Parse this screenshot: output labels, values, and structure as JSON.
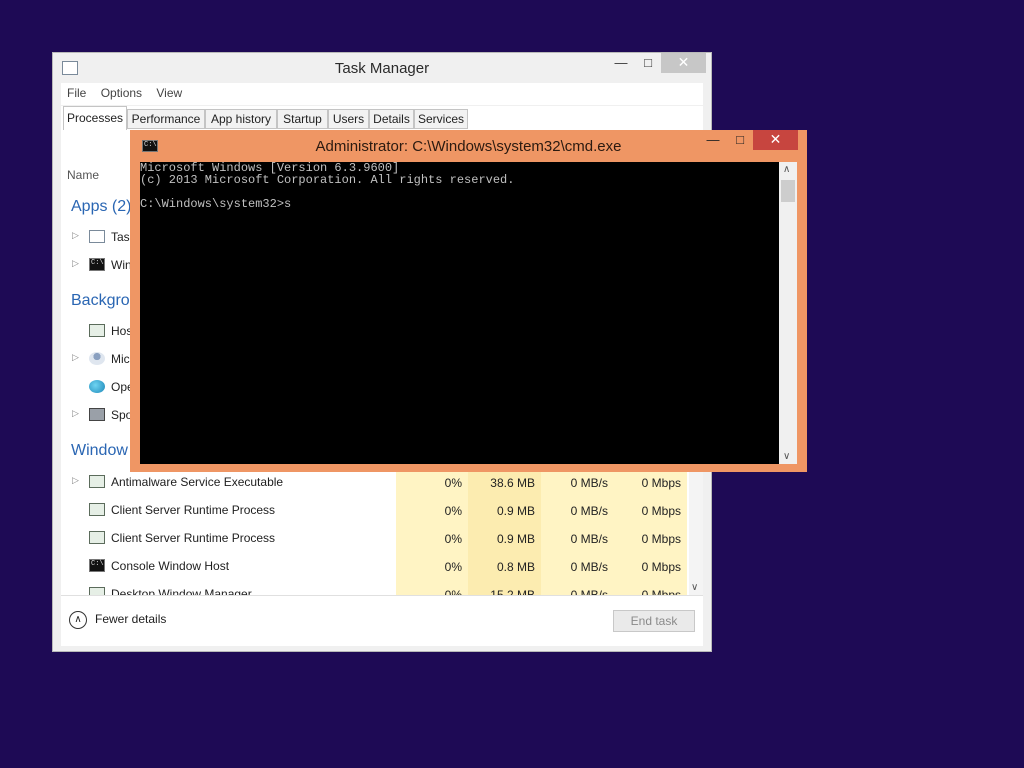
{
  "task_manager": {
    "title": "Task Manager",
    "menu": [
      "File",
      "Options",
      "View"
    ],
    "tabs": [
      "Processes",
      "Performance",
      "App history",
      "Startup",
      "Users",
      "Details",
      "Services"
    ],
    "active_tab": "Processes",
    "column_name": "Name",
    "groups": {
      "apps": "Apps (2)",
      "background": "Backgrou",
      "windows": "Window"
    },
    "apps": [
      {
        "name": "Tas",
        "icon": "task-manager-icon",
        "expandable": true
      },
      {
        "name": "Win",
        "icon": "cmd-icon",
        "expandable": true
      }
    ],
    "background": [
      {
        "name": "Hos",
        "icon": "host-process-icon",
        "expandable": false
      },
      {
        "name": "Mic",
        "icon": "user-icon",
        "expandable": true
      },
      {
        "name": "Ope",
        "icon": "globe-icon",
        "expandable": false
      },
      {
        "name": "Spo",
        "icon": "printer-icon",
        "expandable": true
      }
    ],
    "windows_processes": [
      {
        "name": "Antimalware Service Executable",
        "icon": "host-process-icon",
        "expandable": true,
        "cpu": "0%",
        "memory": "38.6 MB",
        "disk": "0 MB/s",
        "network": "0 Mbps"
      },
      {
        "name": "Client Server Runtime Process",
        "icon": "host-process-icon",
        "expandable": false,
        "cpu": "0%",
        "memory": "0.9 MB",
        "disk": "0 MB/s",
        "network": "0 Mbps"
      },
      {
        "name": "Client Server Runtime Process",
        "icon": "host-process-icon",
        "expandable": false,
        "cpu": "0%",
        "memory": "0.9 MB",
        "disk": "0 MB/s",
        "network": "0 Mbps"
      },
      {
        "name": "Console Window Host",
        "icon": "cmd-icon",
        "expandable": false,
        "cpu": "0%",
        "memory": "0.8 MB",
        "disk": "0 MB/s",
        "network": "0 Mbps"
      },
      {
        "name": "Desktop Window Manager",
        "icon": "host-process-icon",
        "expandable": false,
        "cpu": "0%",
        "memory": "15.2 MB",
        "disk": "0 MB/s",
        "network": "0 Mbps"
      }
    ],
    "fewer_details": "Fewer details",
    "end_task": "End task"
  },
  "cmd": {
    "title": "Administrator: C:\\Windows\\system32\\cmd.exe",
    "lines": [
      "Microsoft Windows [Version 6.3.9600]",
      "(c) 2013 Microsoft Corporation. All rights reserved.",
      "",
      "C:\\Windows\\system32>s"
    ]
  },
  "colors": {
    "desktop": "#1e0a55",
    "cmd_frame": "#ef9664",
    "close_button_active": "#c7453f",
    "group_heading": "#2a66b3",
    "cpu_column_tint": "#fff4c4"
  }
}
